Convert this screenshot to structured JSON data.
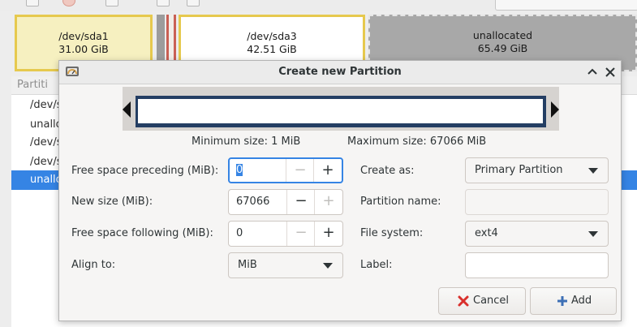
{
  "partition_map": [
    {
      "device": "/dev/sda1",
      "size": "31.00 GiB"
    },
    {
      "device": "/dev/sda3",
      "size": "42.51 GiB"
    },
    {
      "device": "unallocated",
      "size": "65.49 GiB"
    }
  ],
  "partition_list": {
    "header": "Partiti",
    "rows": [
      "/dev/s",
      "unallo",
      "/dev/s",
      "/dev/s",
      "unallo"
    ],
    "selected_index": 4
  },
  "dialog": {
    "title": "Create new Partition",
    "min_size": "Minimum size: 1 MiB",
    "max_size": "Maximum size: 67066 MiB",
    "left": {
      "free_preceding_label": "Free space preceding (MiB):",
      "free_preceding_value": "0",
      "new_size_label": "New size (MiB):",
      "new_size_value": "67066",
      "free_following_label": "Free space following (MiB):",
      "free_following_value": "0",
      "align_label": "Align to:",
      "align_value": "MiB"
    },
    "right": {
      "create_as_label": "Create as:",
      "create_as_value": "Primary Partition",
      "partition_name_label": "Partition name:",
      "partition_name_value": "",
      "file_system_label": "File system:",
      "file_system_value": "ext4",
      "label_label": "Label:",
      "label_value": ""
    },
    "buttons": {
      "cancel": "Cancel",
      "add": "Add"
    },
    "icons": [
      "gparted-app-icon",
      "minimize-icon",
      "close-icon",
      "cancel-icon",
      "add-icon"
    ]
  },
  "colors": {
    "accent": "#3584e4",
    "partition_border": "#e6c94e",
    "resize_bar": "#243e63",
    "unallocated": "#a8a8a8"
  }
}
